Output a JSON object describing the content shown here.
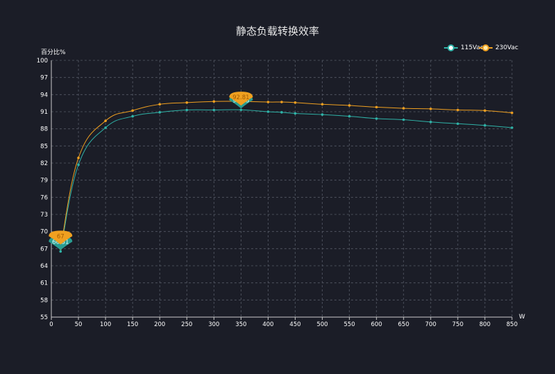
{
  "chart_data": {
    "type": "line",
    "title": "静态负载转换效率",
    "ylabel": "百分比%",
    "xlabel": "W",
    "xlim": [
      0,
      850
    ],
    "ylim": [
      55,
      100
    ],
    "xticks": [
      0,
      50,
      100,
      150,
      200,
      250,
      300,
      350,
      400,
      450,
      500,
      550,
      600,
      650,
      700,
      750,
      800,
      850
    ],
    "yticks": [
      55,
      58,
      61,
      64,
      67,
      70,
      73,
      76,
      79,
      82,
      85,
      88,
      91,
      94,
      97,
      100
    ],
    "grid": true,
    "legend_position": "top-right",
    "x": [
      17,
      50,
      100,
      150,
      200,
      250,
      300,
      350,
      400,
      425,
      450,
      500,
      550,
      600,
      650,
      700,
      750,
      800,
      850
    ],
    "series": [
      {
        "name": "115Vac",
        "color": "#2fb3a8",
        "values": [
          66.51,
          81.7,
          88.2,
          90.2,
          90.9,
          91.3,
          91.3,
          91.33,
          91.0,
          90.9,
          90.7,
          90.5,
          90.2,
          89.8,
          89.6,
          89.2,
          88.9,
          88.6,
          88.2
        ],
        "labels": [
          {
            "x": 17,
            "value": "66.51"
          },
          {
            "x": 350,
            "value": "91.33"
          }
        ]
      },
      {
        "name": "230Vac",
        "color": "#f0a020",
        "values": [
          67,
          82.9,
          89.4,
          91.2,
          92.3,
          92.6,
          92.8,
          92.81,
          92.7,
          92.7,
          92.6,
          92.3,
          92.1,
          91.8,
          91.6,
          91.5,
          91.3,
          91.2,
          90.8
        ],
        "labels": [
          {
            "x": 17,
            "value": "67"
          },
          {
            "x": 350,
            "value": "92.81"
          }
        ]
      }
    ]
  }
}
